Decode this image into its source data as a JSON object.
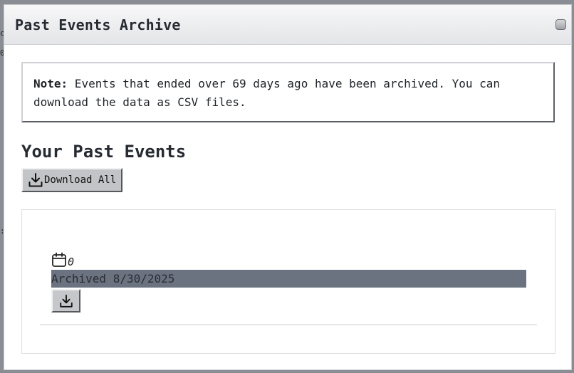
{
  "dialog": {
    "title": "Past Events Archive",
    "close_icon": "close-icon"
  },
  "note": {
    "label": "Note:",
    "text": " Events that ended over 69 days ago have been archived. You can download the data as CSV files."
  },
  "section": {
    "title": "Your Past Events",
    "download_all_label": "Download All",
    "download_all_icon": "download-icon"
  },
  "events": [
    {
      "icon": "calendar-icon",
      "count": "0",
      "archived_text": "Archived 8/30/2025",
      "download_icon": "download-icon"
    }
  ],
  "colors": {
    "archived_bg": "#6b7280",
    "overlay": "#8a8d93"
  }
}
